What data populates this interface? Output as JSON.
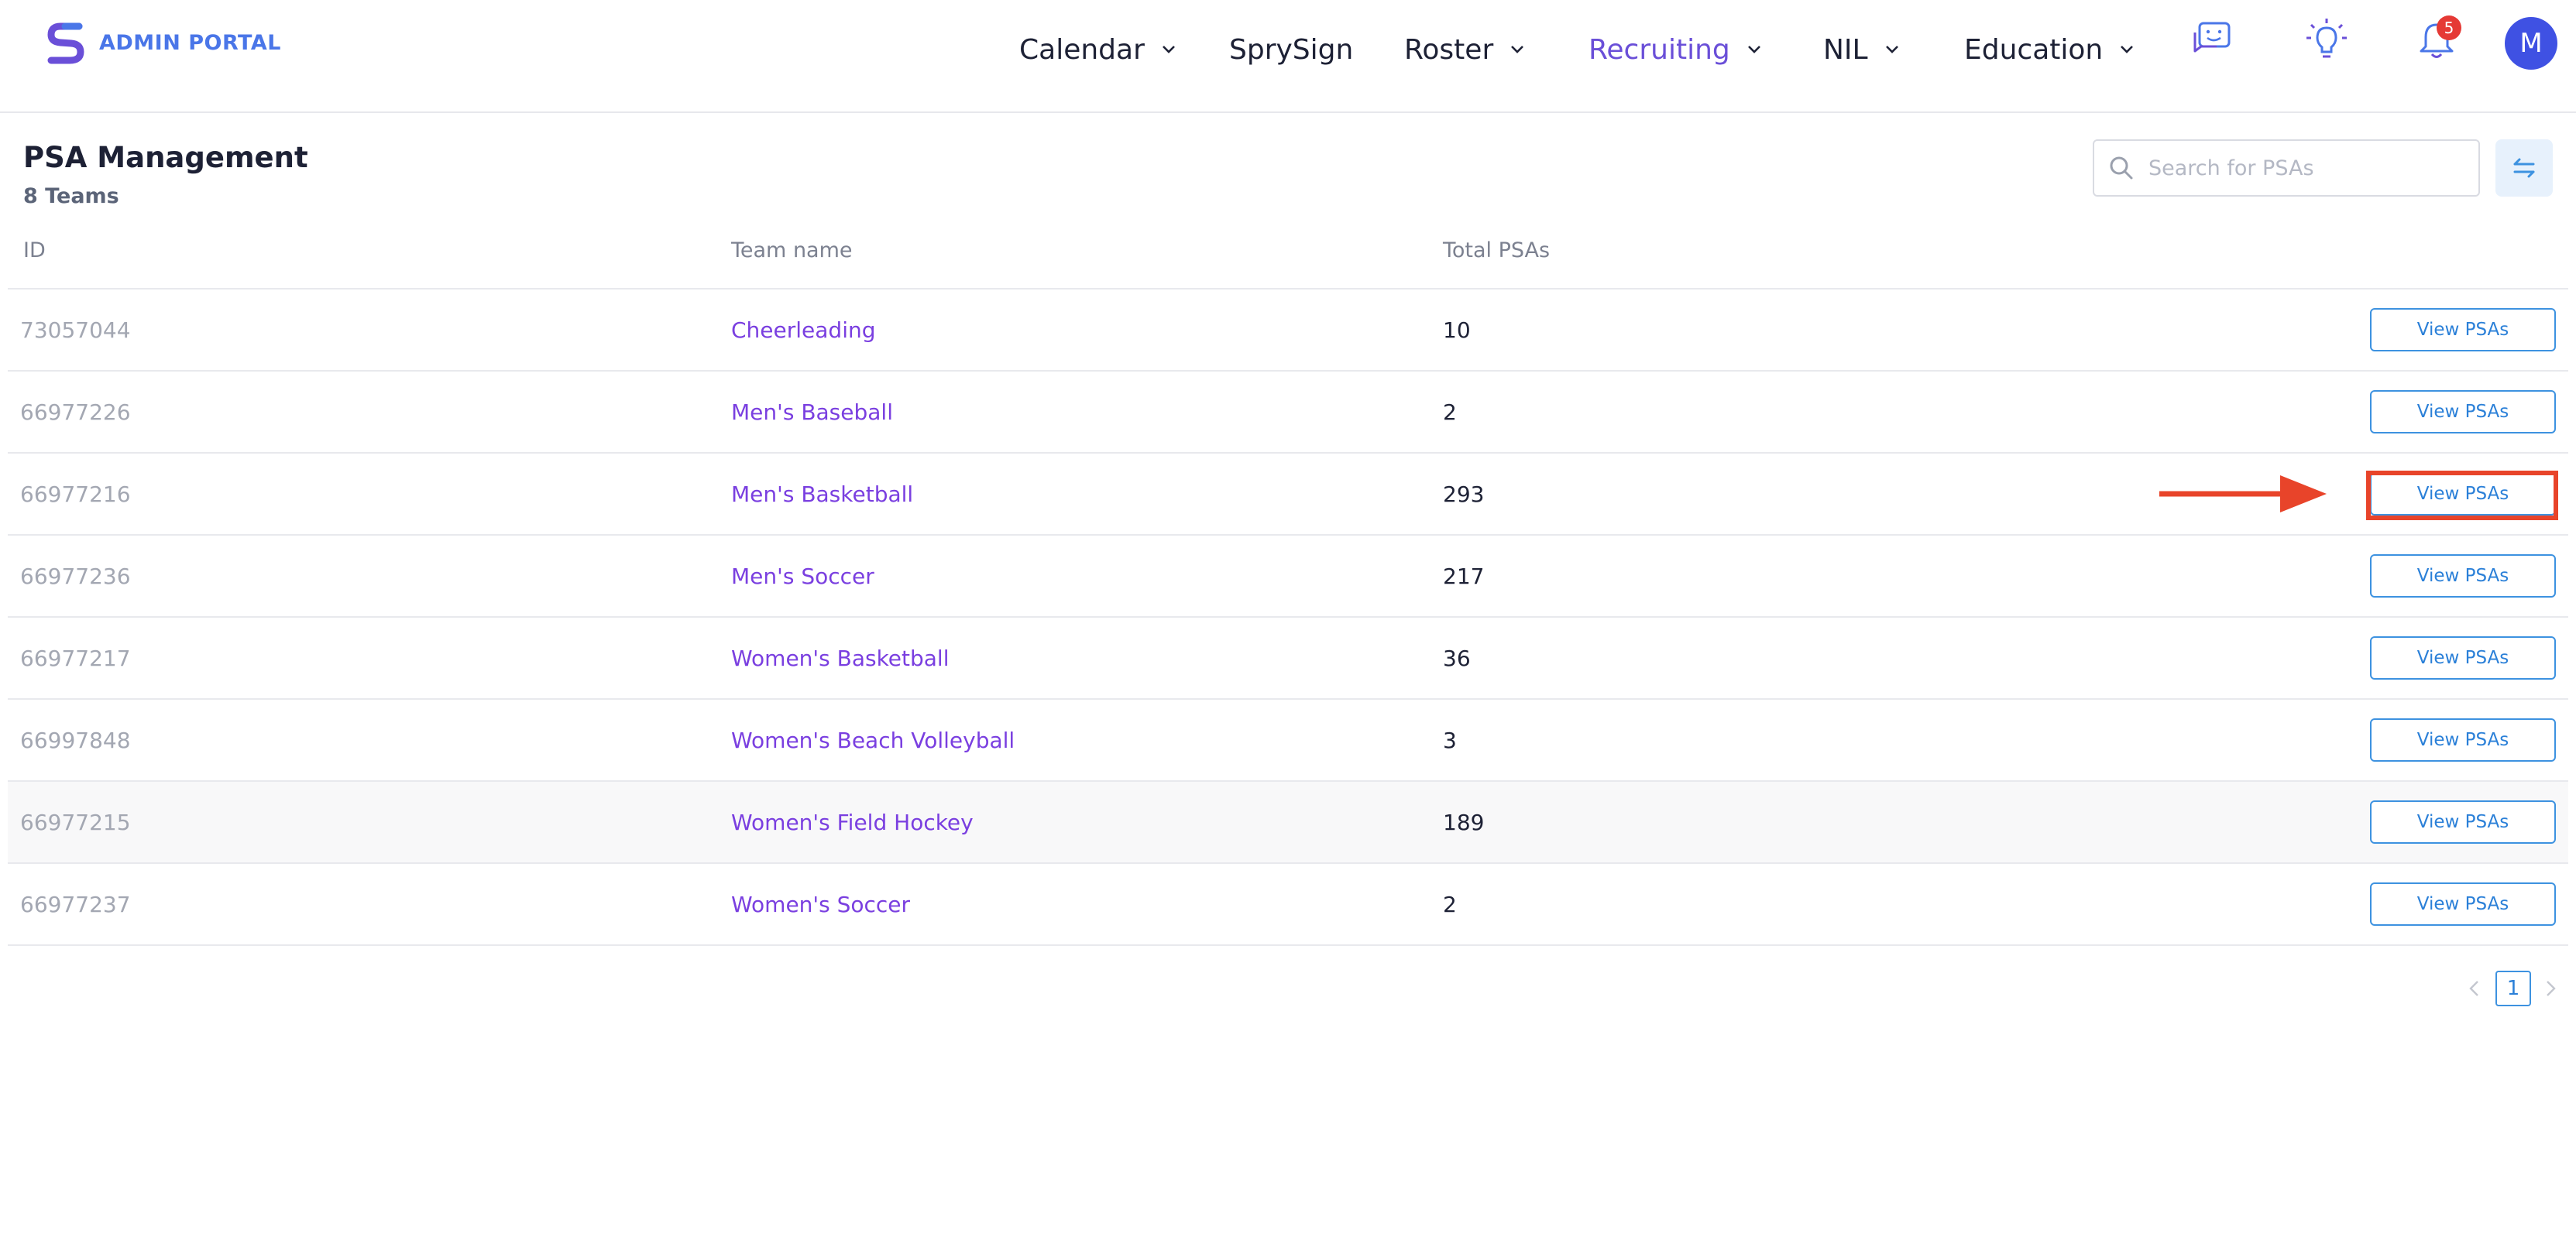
{
  "header": {
    "brand": "ADMIN PORTAL",
    "nav": [
      {
        "label": "Calendar"
      },
      {
        "label": "SprySign"
      },
      {
        "label": "Roster"
      },
      {
        "label": "Recruiting"
      },
      {
        "label": "NIL"
      },
      {
        "label": "Education"
      }
    ],
    "notification_count": "5",
    "avatar_initial": "M"
  },
  "page": {
    "title": "PSA Management",
    "subtitle": "8 Teams",
    "search_placeholder": "Search for PSAs"
  },
  "table": {
    "columns": [
      "ID",
      "Team name",
      "Total PSAs"
    ],
    "action_label": "View PSAs",
    "rows": [
      {
        "id": "73057044",
        "team": "Cheerleading",
        "total": "10"
      },
      {
        "id": "66977226",
        "team": "Men's Baseball",
        "total": "2"
      },
      {
        "id": "66977216",
        "team": "Men's Basketball",
        "total": "293"
      },
      {
        "id": "66977236",
        "team": "Men's Soccer",
        "total": "217"
      },
      {
        "id": "66977217",
        "team": "Women's Basketball",
        "total": "36"
      },
      {
        "id": "66997848",
        "team": "Women's Beach Volleyball",
        "total": "3"
      },
      {
        "id": "66977215",
        "team": "Women's Field Hockey",
        "total": "189"
      },
      {
        "id": "66977237",
        "team": "Women's Soccer",
        "total": "2"
      }
    ]
  },
  "pagination": {
    "current_page": "1"
  },
  "colors": {
    "accent_purple": "#7a3fe0",
    "accent_blue": "#3d92e0",
    "annotation_red": "#e8442a",
    "badge_red": "#e53935"
  }
}
